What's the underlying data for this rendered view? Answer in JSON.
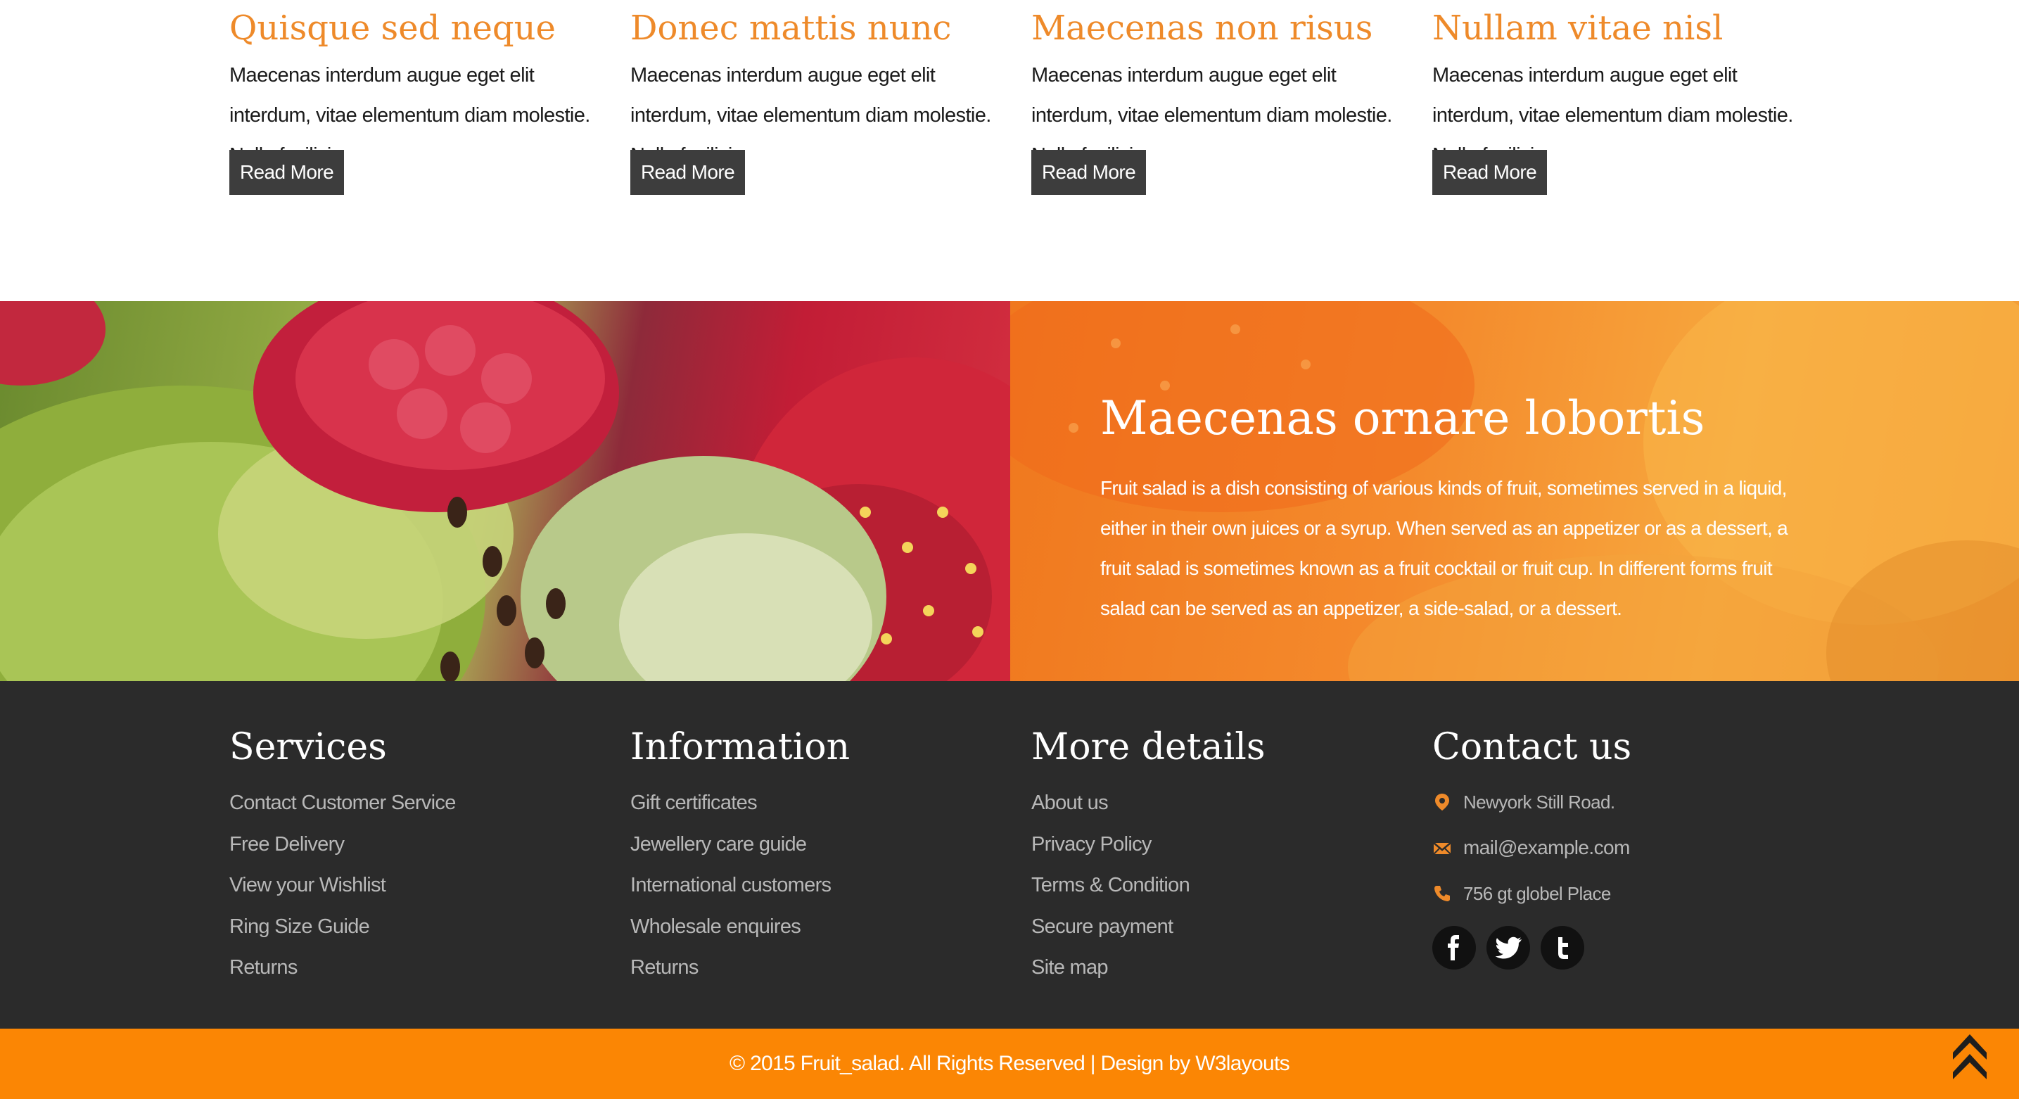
{
  "articles": [
    {
      "title": "Quisque sed neque",
      "text": "Maecenas interdum augue eget elit interdum, vitae elementum diam molestie. Nulla facilisi.",
      "button": "Read More"
    },
    {
      "title": "Donec mattis nunc",
      "text": "Maecenas interdum augue eget elit interdum, vitae elementum diam molestie. Nulla facilisi.",
      "button": "Read More"
    },
    {
      "title": "Maecenas non risus",
      "text": "Maecenas interdum augue eget elit interdum, vitae elementum diam molestie. Nulla facilisi.",
      "button": "Read More"
    },
    {
      "title": "Nullam vitae nisl",
      "text": "Maecenas interdum augue eget elit interdum, vitae elementum diam molestie. Nulla facilisi.",
      "button": "Read More"
    }
  ],
  "banner": {
    "title": "Maecenas ornare lobortis",
    "text": "Fruit salad is a dish consisting of various kinds of fruit, sometimes served in a liquid, either in their own juices or a syrup. When served as an appetizer or as a dessert, a fruit salad is sometimes known as a fruit cocktail or fruit cup. In different forms fruit salad can be served as an appetizer, a side-salad, or a dessert."
  },
  "footer": {
    "services": {
      "heading": "Services",
      "links": [
        "Contact Customer Service",
        "Free Delivery",
        "View your Wishlist",
        "Ring Size Guide",
        "Returns"
      ]
    },
    "information": {
      "heading": "Information",
      "links": [
        "Gift certificates",
        "Jewellery care guide",
        "International customers",
        "Wholesale enquires",
        "Returns"
      ]
    },
    "more_details": {
      "heading": "More details",
      "links": [
        "About us",
        "Privacy Policy",
        "Terms & Condition",
        "Secure payment",
        "Site map"
      ]
    },
    "contact": {
      "heading": "Contact us",
      "address": "Newyork Still Road.",
      "email": "mail@example.com",
      "phone": "756 gt globel Place",
      "address_icon": "map-pin-icon",
      "email_icon": "envelope-icon",
      "phone_icon": "phone-icon",
      "social_icons": [
        "facebook-icon",
        "twitter-icon",
        "tumblr-icon"
      ]
    }
  },
  "copyright": "© 2015 Fruit_salad. All Rights Reserved | Design by W3layouts",
  "scroll_top_icon": "double-chevron-up-icon",
  "colors": {
    "accent": "#ee8a2a",
    "button_bg": "#3d3d3d",
    "footer_bg": "#2b2b2b",
    "bottom_bar": "#fb8604",
    "footer_link": "#b8b8b8"
  }
}
